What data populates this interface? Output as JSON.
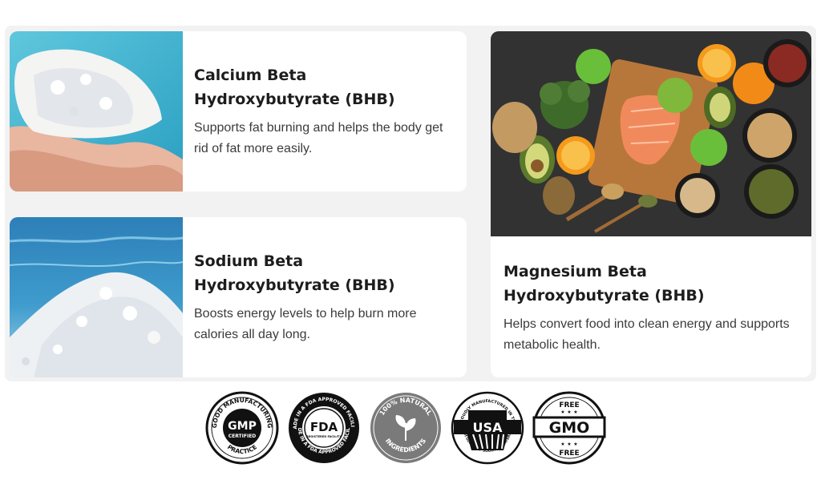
{
  "cards": [
    {
      "title_line1": "Calcium Beta",
      "title_line2": "Hydroxybutyrate (BHB)",
      "description": "Supports fat burning and helps the body get rid of fat more easily."
    },
    {
      "title_line1": "Sodium Beta",
      "title_line2": "Hydroxybutyrate (BHB)",
      "description": "Boosts energy levels to help burn more calories all day long."
    },
    {
      "title_line1": "Magnesium Beta",
      "title_line2": "Hydroxybutyrate (BHB)",
      "description": "Helps convert food into clean energy and supports metabolic health."
    }
  ],
  "badges": {
    "gmp": {
      "ring_top": "GOOD MANUFACTURING",
      "ring_bottom": "PRACTICE",
      "main": "GMP",
      "sub": "CERTIFIED",
      "icon": "gmp-badge-icon"
    },
    "fda": {
      "ring_top": "MADE IN A FDA APPROVED FACILITY",
      "ring_bottom": "MADE IN A FDA APPROVED FACILITY",
      "main": "FDA",
      "sub": "REGISTERED FACILITY",
      "icon": "fda-badge-icon"
    },
    "natural": {
      "ring_top": "100% NATURAL",
      "ring_bottom": "INGREDIENTS",
      "icon": "leaf-icon"
    },
    "usa": {
      "ring_top": "PROUDLY MANUFACTURED IN THE",
      "main": "USA",
      "ring_bottom": "WITH GLOBALLY SOURCED MATERIALS",
      "icon": "usa-flag-icon"
    },
    "gmo": {
      "top": "FREE",
      "main": "GMO",
      "bottom": "FREE",
      "icon": "gmo-free-icon"
    }
  },
  "colors": {
    "panel_bg": "#f2f2f2",
    "card_bg": "#ffffff",
    "title": "#1d1d1d",
    "desc": "#3b3b3b",
    "badge_dark": "#111111",
    "badge_grey": "#7a7a7a"
  }
}
